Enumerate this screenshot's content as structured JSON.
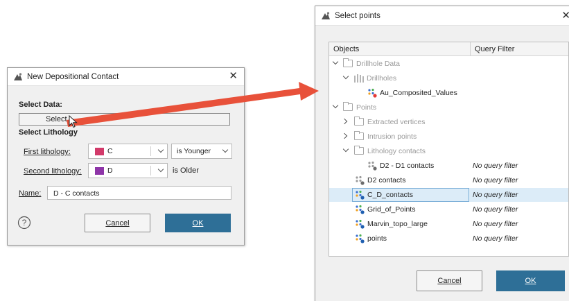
{
  "depositional_dialog": {
    "title": "New Depositional Contact",
    "select_data_label": "Select Data:",
    "select_data_accel": "e",
    "select_button": "Select",
    "select_lithology_label": "Select Lithology",
    "first_lithology_label": "First lithology:",
    "first_lithology_value": "C",
    "first_lithology_color": "#d23a6a",
    "first_relation_value": "is Younger",
    "second_lithology_label": "Second lithology:",
    "second_lithology_value": "D",
    "second_lithology_color": "#8e35a8",
    "second_relation_text": "is Older",
    "name_label": "Name:",
    "name_value": "D - C contacts",
    "cancel_label": "Cancel",
    "ok_label": "OK"
  },
  "select_points_dialog": {
    "title": "Select points",
    "columns": {
      "objects": "Objects",
      "query_filter": "Query Filter"
    },
    "tree": [
      {
        "label": "Drillhole Data",
        "gray": true
      },
      {
        "label": "Drillholes",
        "gray": true
      },
      {
        "label": "Au_Composited_Values",
        "gray": false
      },
      {
        "label": "Points",
        "gray": true
      },
      {
        "label": "Extracted vertices",
        "gray": true
      },
      {
        "label": "Intrusion points",
        "gray": true
      },
      {
        "label": "Lithology contacts",
        "gray": true
      },
      {
        "label": "D2 - D1 contacts",
        "gray": false,
        "filter": "No query filter"
      },
      {
        "label": "D2 contacts",
        "gray": false,
        "filter": "No query filter"
      },
      {
        "label": "C_D_contacts",
        "gray": false,
        "filter": "No query filter",
        "selected": true
      },
      {
        "label": "Grid_of_Points",
        "gray": false,
        "filter": "No query filter"
      },
      {
        "label": "Marvin_topo_large",
        "gray": false,
        "filter": "No query filter"
      },
      {
        "label": "points",
        "gray": false,
        "filter": "No query filter"
      }
    ],
    "cancel_label": "Cancel",
    "ok_label": "OK"
  },
  "colors": {
    "primary_button": "#2e6f97",
    "selection": "#dcecf8",
    "arrow": "#e8513a"
  },
  "icons": [
    "app-icon",
    "close-icon",
    "help-icon",
    "folder-icon",
    "drillhole-icon",
    "points-icon",
    "chevron-down-icon",
    "chevron-right-icon",
    "mouse-cursor-icon"
  ]
}
